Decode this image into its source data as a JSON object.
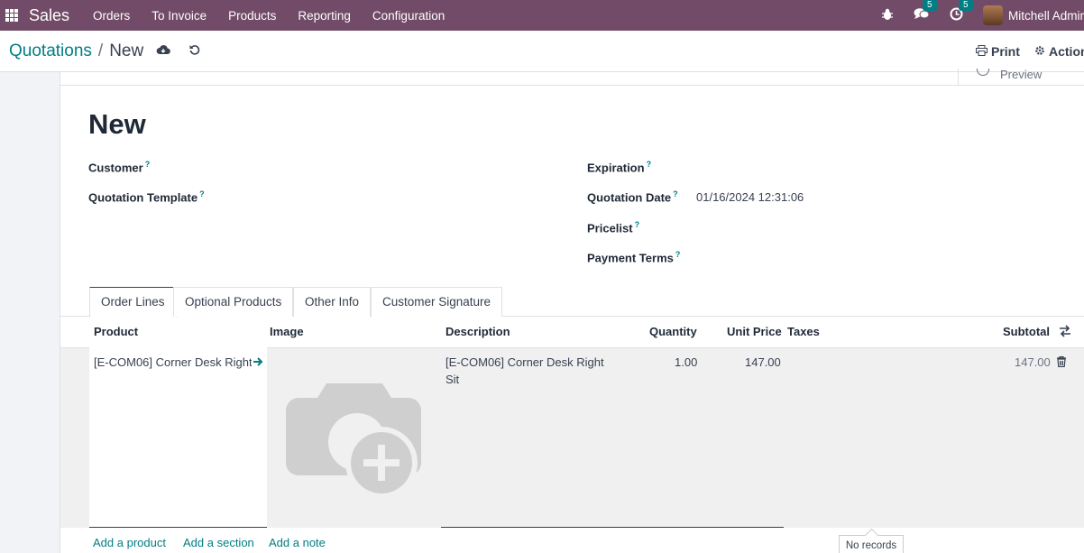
{
  "topbar": {
    "app_name": "Sales",
    "menu": [
      "Orders",
      "To Invoice",
      "Products",
      "Reporting",
      "Configuration"
    ],
    "messages_count": "5",
    "activities_count": "5",
    "user_name": "Mitchell Admin"
  },
  "breadcrumb": {
    "parent": "Quotations",
    "separator": "/",
    "current": "New"
  },
  "actions": {
    "print": "Print",
    "action": "Action"
  },
  "preview_label": "Preview",
  "form": {
    "title": "New",
    "customer_label": "Customer",
    "template_label": "Quotation Template",
    "expiration_label": "Expiration",
    "quotation_date_label": "Quotation Date",
    "quotation_date_value": "01/16/2024 12:31:06",
    "pricelist_label": "Pricelist",
    "payment_terms_label": "Payment Terms",
    "help_mark": "?"
  },
  "tabs": [
    "Order Lines",
    "Optional Products",
    "Other Info",
    "Customer Signature"
  ],
  "table": {
    "headers": {
      "product": "Product",
      "image": "Image",
      "description": "Description",
      "quantity": "Quantity",
      "unit_price": "Unit Price",
      "taxes": "Taxes",
      "subtotal": "Subtotal"
    },
    "row": {
      "product": "[E-COM06] Corner Desk Right Sit",
      "description_line1": "[E-COM06] Corner Desk Right",
      "description_line2": "Sit",
      "quantity": "1.00",
      "unit_price": "147.00",
      "subtotal": "147.00"
    },
    "add_product": "Add a product",
    "add_section": "Add a section",
    "add_note": "Add a note"
  },
  "tooltip": "No records",
  "colors": {
    "brand": "#714b67",
    "accent": "#017e84"
  }
}
